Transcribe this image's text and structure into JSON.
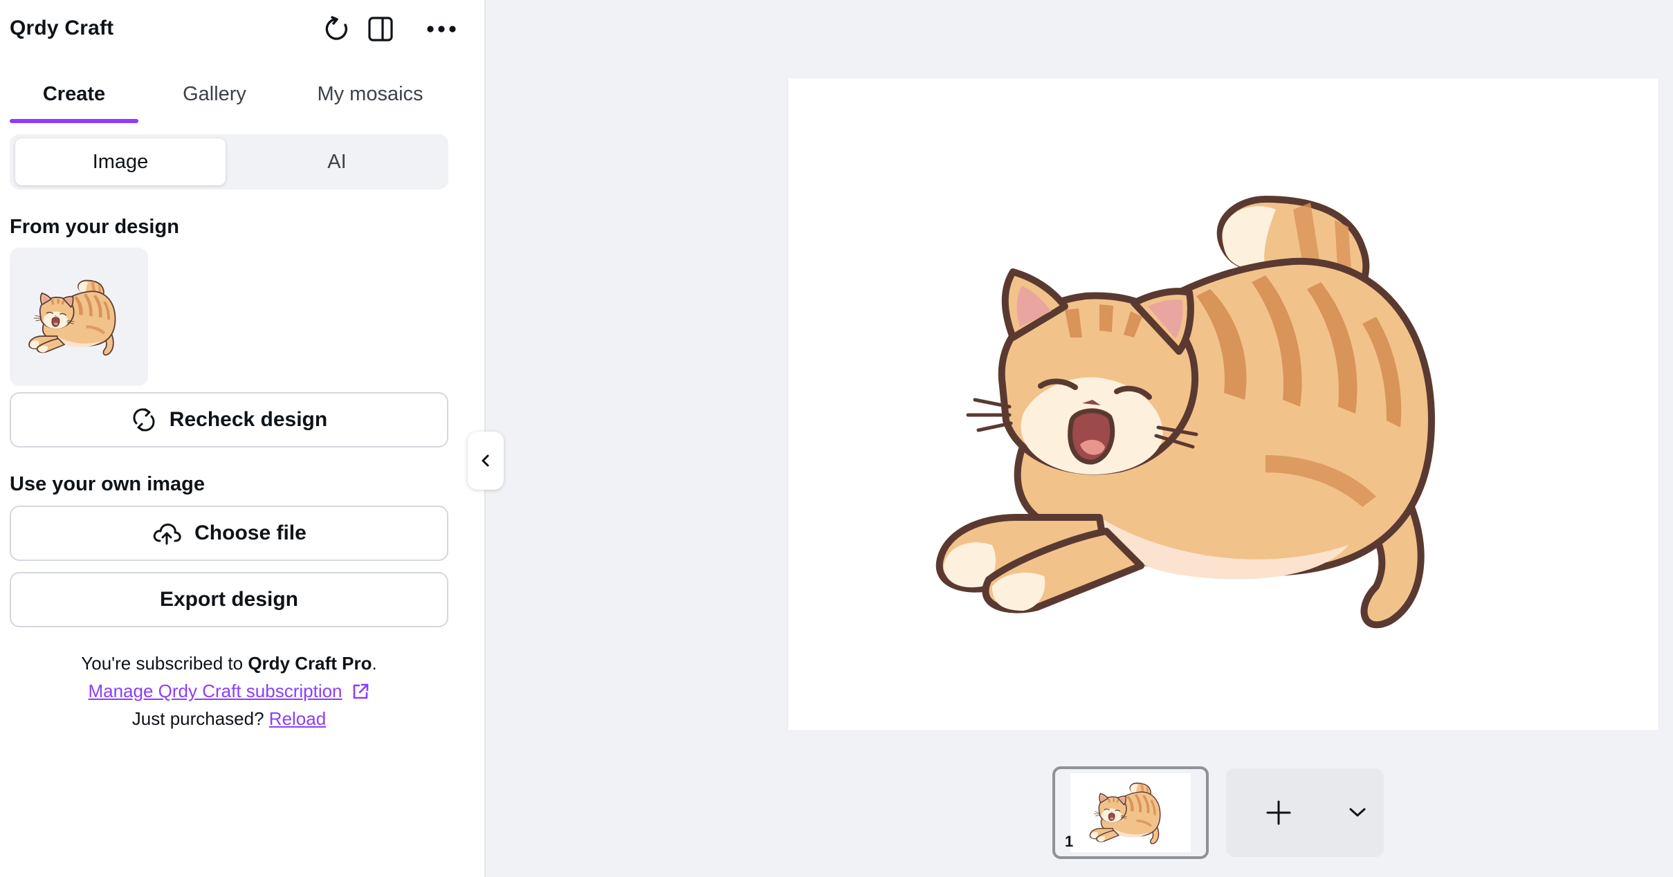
{
  "app": {
    "title": "Qrdy Craft"
  },
  "header": {
    "icons": [
      "refresh-icon",
      "side-panel-icon",
      "more-icon"
    ]
  },
  "tabs": [
    {
      "label": "Create",
      "active": true
    },
    {
      "label": "Gallery",
      "active": false
    },
    {
      "label": "My mosaics",
      "active": false
    }
  ],
  "segments": [
    {
      "label": "Image",
      "active": true
    },
    {
      "label": "AI",
      "active": false
    }
  ],
  "design_section": {
    "heading": "From your design",
    "recheck_label": "Recheck design"
  },
  "own_image_section": {
    "heading": "Use your own image",
    "choose_file_label": "Choose file",
    "export_label": "Export design"
  },
  "subscription": {
    "prefix": "You're subscribed to ",
    "plan": "Qrdy Craft Pro",
    "suffix": ".",
    "manage_link": "Manage Qrdy Craft subscription",
    "purchased_prefix": "Just purchased? ",
    "reload_link": "Reload"
  },
  "pages": {
    "current_page": "1"
  },
  "colors": {
    "accent": "#8b3dff",
    "cat_body": "#f2c28b",
    "cat_stripes": "#d9945a",
    "cat_outline": "#5a3a30",
    "cat_cream": "#fdf1de",
    "workspace_bg": "#f1f2f5"
  }
}
